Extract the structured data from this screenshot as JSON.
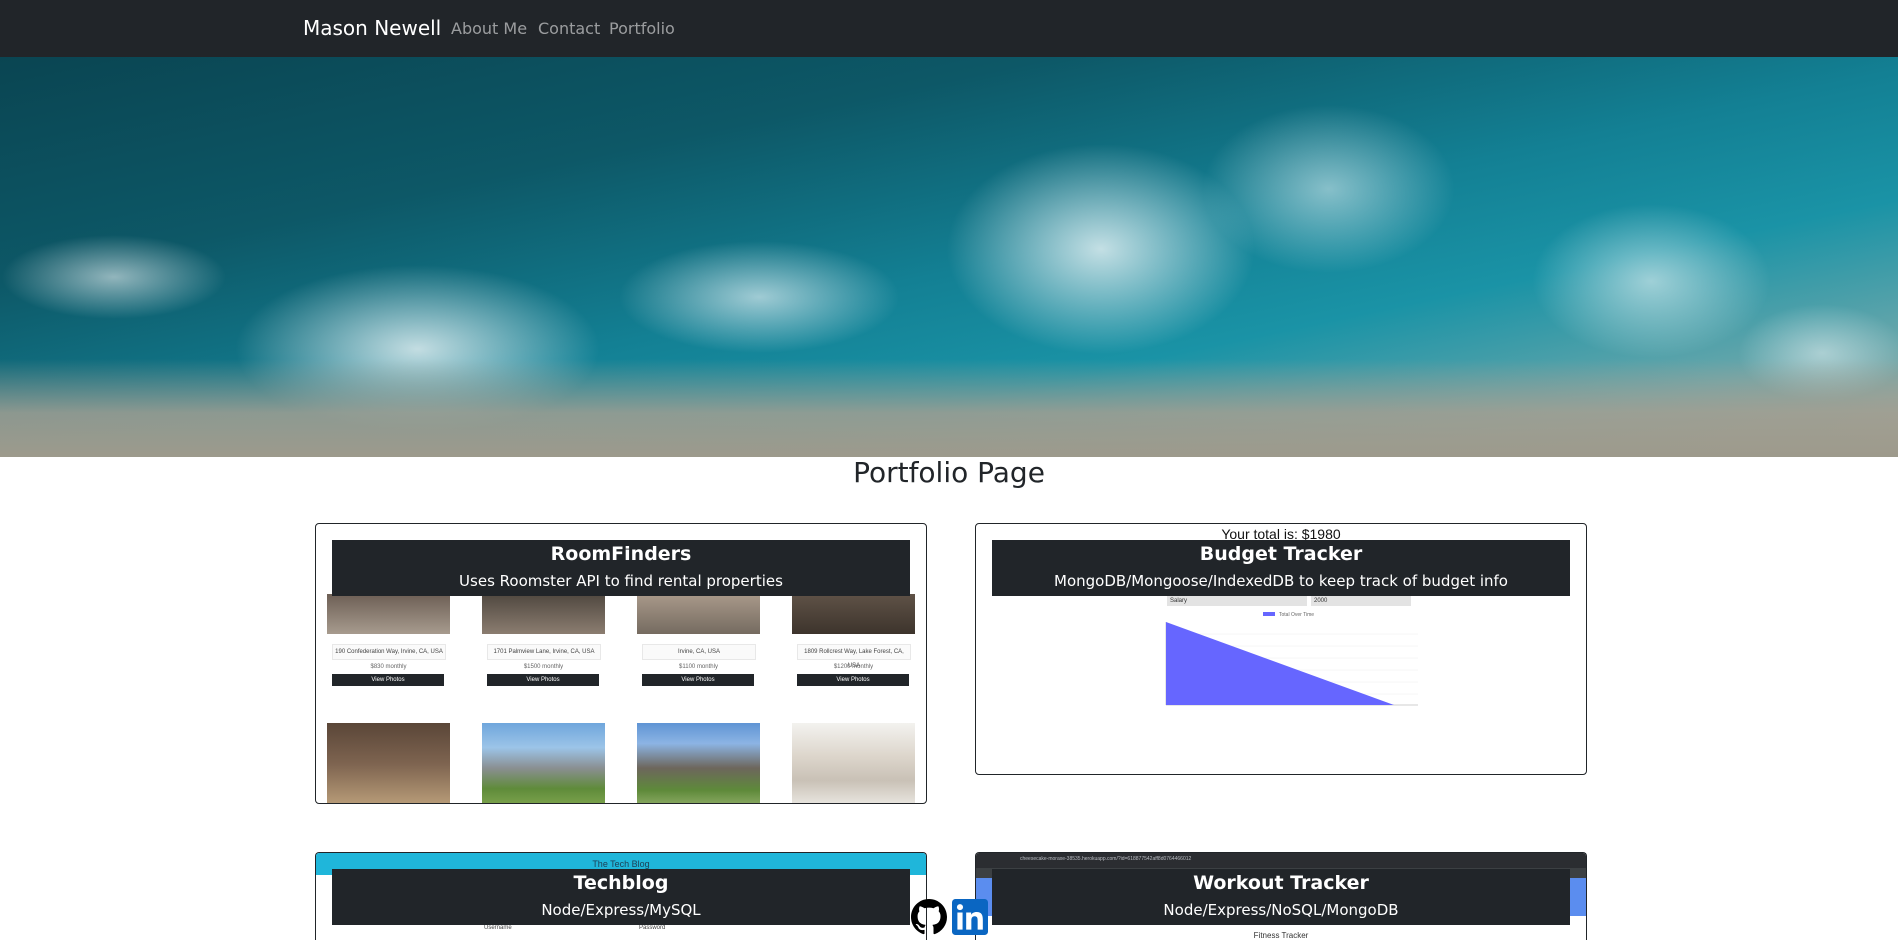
{
  "nav": {
    "brand": "Mason Newell",
    "links": [
      "About Me",
      "Contact",
      "Portfolio"
    ]
  },
  "page_title": "Portfolio Page",
  "projects": [
    {
      "title": "RoomFinders",
      "description": "Uses Roomster API to find rental properties",
      "preview": {
        "listings": [
          {
            "address": "190 Confederation Way, Irvine, CA, USA",
            "price": "$830 monthly",
            "button": "View Photos"
          },
          {
            "address": "1701 Palmview Lane, Irvine, CA, USA",
            "price": "$1500 monthly",
            "button": "View Photos"
          },
          {
            "address": "Irvine, CA, USA",
            "price": "$1100 monthly",
            "button": "View Photos"
          },
          {
            "address": "1809 Rollcrest Way, Lake Forest, CA, USA",
            "price": "$1200 monthly",
            "button": "View Photos"
          }
        ]
      }
    },
    {
      "title": "Budget Tracker",
      "description": "MongoDB/Mongoose/IndexedDB to keep track of budget info",
      "preview": {
        "total_text": "Your total is: $1980",
        "row": {
          "name": "Salary",
          "value": "2000"
        },
        "legend": "Total Over Time",
        "series_color": "#6666ff"
      }
    },
    {
      "title": "Techblog",
      "description": "Node/Express/MySQL",
      "preview": {
        "header": "The Tech Blog",
        "fields": [
          "Username",
          "Password"
        ],
        "bar_color": "#1fb6da"
      }
    },
    {
      "title": "Workout Tracker",
      "description": "Node/Express/NoSQL/MongoDB",
      "preview": {
        "url": "cheesecake-moraxe-38535.herokuapp.com/?id=618877542aff8d0764466012",
        "header": "Fitness Tracker"
      }
    }
  ],
  "social": {
    "icons": [
      "github-icon",
      "linkedin-icon"
    ],
    "linkedin_color": "#0a66c2"
  }
}
